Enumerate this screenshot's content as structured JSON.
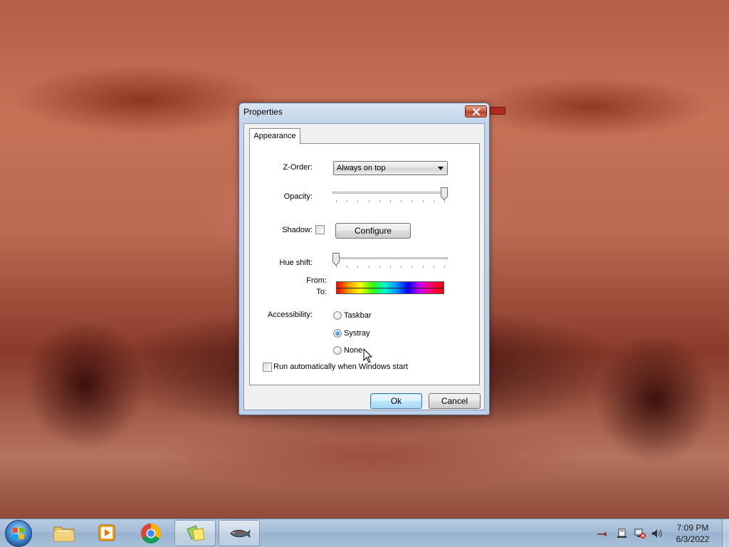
{
  "dialog": {
    "title": "Properties",
    "tab_label": "Appearance",
    "zorder": {
      "label": "Z-Order:",
      "value": "Always on top"
    },
    "opacity": {
      "label": "Opacity:",
      "level": 1.0
    },
    "shadow": {
      "label": "Shadow:",
      "checked": false,
      "configure_label": "Configure"
    },
    "hue_shift": {
      "label": "Hue shift:",
      "level": 0.0,
      "from_label": "From:",
      "to_label": "To:"
    },
    "accessibility": {
      "label": "Accessibility:",
      "options": [
        {
          "label": "Taskbar",
          "checked": false
        },
        {
          "label": "Systray",
          "checked": true
        },
        {
          "label": "None",
          "checked": false
        }
      ]
    },
    "autorun_label": "Run automatically when Windows start",
    "ok_label": "Ok",
    "cancel_label": "Cancel"
  },
  "taskbar": {
    "pinned": [
      "windows-explorer-icon",
      "media-player-icon",
      "chrome-icon",
      "sticky-notes-icon",
      "fish-app-icon"
    ],
    "clock": {
      "time": "7:09 PM",
      "date": "6/3/2022"
    }
  },
  "colors": {
    "accent": "#3c7fb1",
    "close": "#c75a3f",
    "taskbar": "#a4bcd6"
  }
}
